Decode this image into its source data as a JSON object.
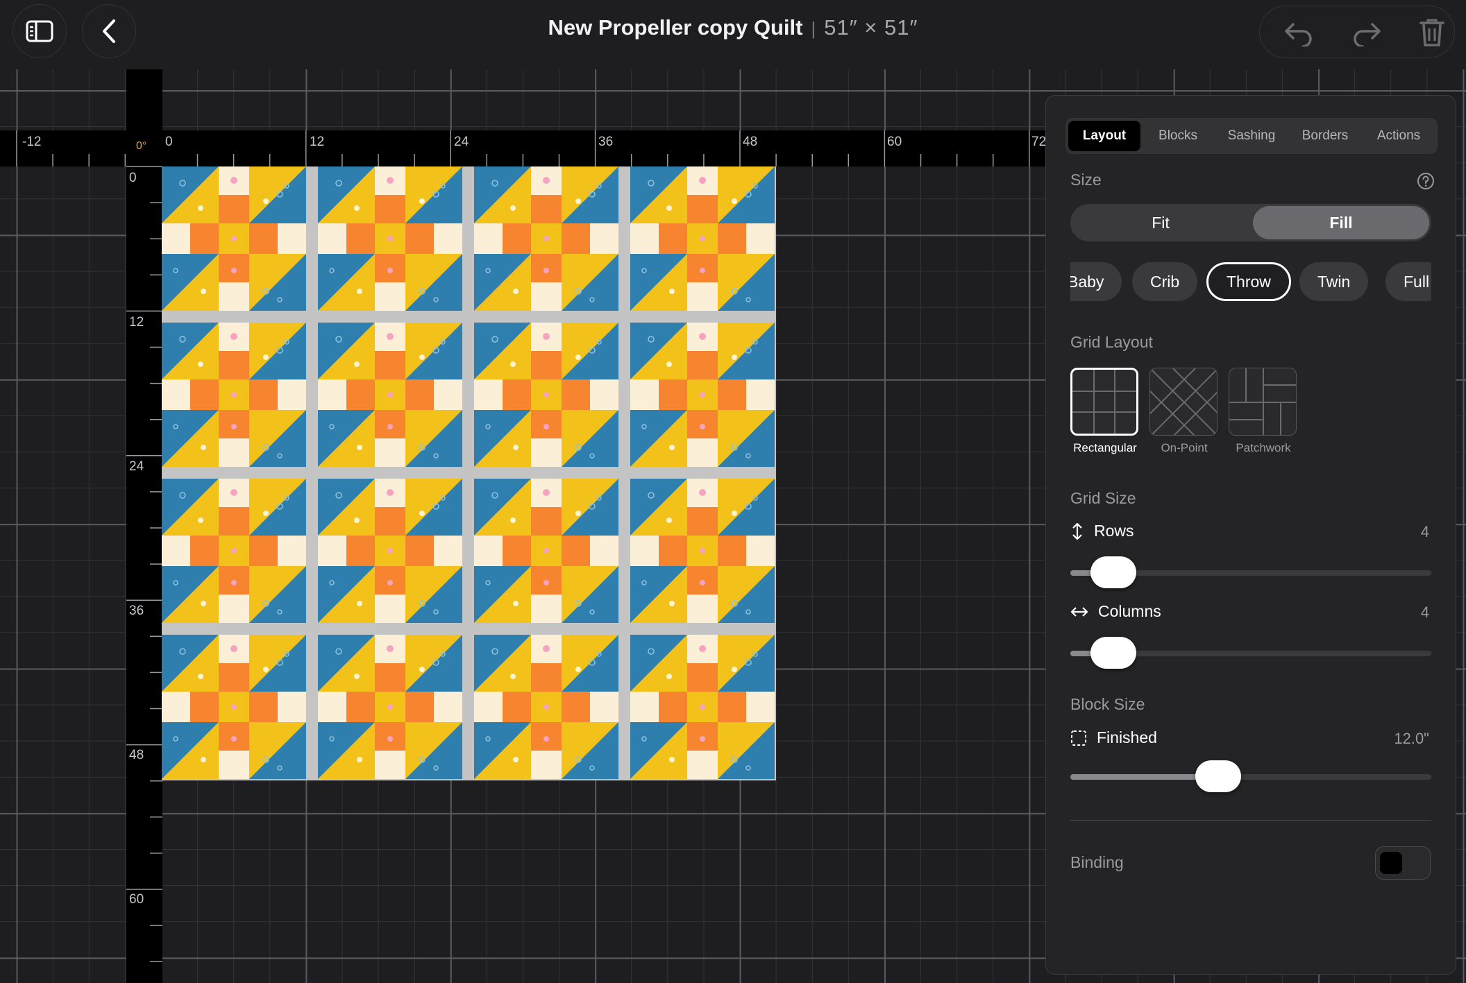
{
  "header": {
    "title": "New Propeller copy Quilt",
    "separator": "|",
    "dimensions": "51″ × 51″",
    "sidebar_icon": "sidebar-toggle-icon",
    "back_icon": "chevron-left-icon",
    "undo_icon": "undo-icon",
    "redo_icon": "redo-icon",
    "delete_icon": "trash-icon"
  },
  "rulers": {
    "angle": "0°",
    "horizontal": [
      "-12",
      "0",
      "12",
      "24",
      "36",
      "48",
      "60",
      "72"
    ],
    "vertical": [
      "0",
      "12",
      "24",
      "36",
      "48",
      "60"
    ]
  },
  "quilt": {
    "rows": 4,
    "columns": 4,
    "colors": {
      "yellow": "#f2c21a",
      "blue": "#2e7fae",
      "orange": "#f7842f",
      "cream": "#fbefd8",
      "sashing": "#c4c4c4"
    }
  },
  "panel": {
    "tabs": [
      "Layout",
      "Blocks",
      "Sashing",
      "Borders",
      "Actions"
    ],
    "active_tab": "Layout",
    "size": {
      "title": "Size",
      "help_icon": "help-circle-icon",
      "fit_label": "Fit",
      "fill_label": "Fill",
      "selected": "Fill",
      "presets": [
        "Baby",
        "Crib",
        "Throw",
        "Twin",
        "Full"
      ],
      "selected_preset": "Throw"
    },
    "grid_layout": {
      "title": "Grid Layout",
      "options": [
        "Rectangular",
        "On-Point",
        "Patchwork"
      ],
      "selected": "Rectangular"
    },
    "grid_size": {
      "title": "Grid Size",
      "rows_label": "Rows",
      "rows_value": "4",
      "rows_icon": "arrows-vertical-icon",
      "columns_label": "Columns",
      "columns_value": "4",
      "columns_icon": "arrows-horizontal-icon",
      "rows_level": 0.12,
      "columns_level": 0.12
    },
    "block_size": {
      "title": "Block Size",
      "finished_label": "Finished",
      "finished_value": "12.0\"",
      "finished_icon": "dashed-square-icon",
      "level": 0.41
    },
    "binding": {
      "title": "Binding",
      "color": "#000000"
    }
  }
}
